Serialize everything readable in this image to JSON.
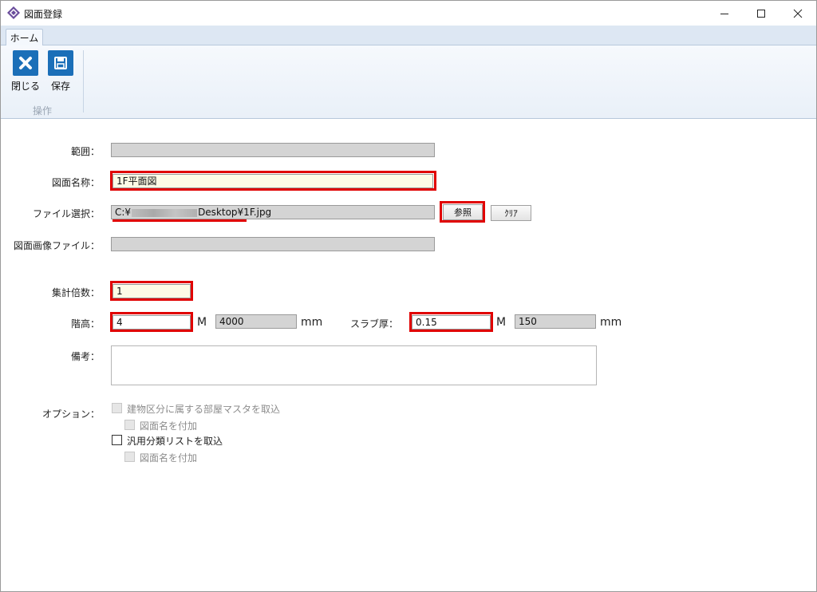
{
  "window": {
    "title": "図面登録"
  },
  "ribbon": {
    "tab": "ホーム",
    "close_label": "閉じる",
    "save_label": "保存",
    "group_label": "操作"
  },
  "form": {
    "range_label": "範囲：",
    "range_value": "",
    "drawing_name_label": "図面名称：",
    "drawing_name_value": "1F平面図",
    "file_select_label": "ファイル選択：",
    "file_path_prefix": "C:¥",
    "file_path_suffix": "Desktop¥1F.jpg",
    "browse_label": "参照",
    "clear_label": "ｸﾘｱ",
    "image_file_label": "図面画像ファイル：",
    "image_file_value": "",
    "multiplier_label": "集計倍数：",
    "multiplier_value": "1",
    "floor_height_label": "階高：",
    "floor_height_value": "4",
    "floor_height_unit": "M",
    "floor_height_mm_value": "4000",
    "floor_height_mm_unit": "mm",
    "slab_label": "スラブ厚：",
    "slab_value": "0.15",
    "slab_unit": "M",
    "slab_mm_value": "150",
    "slab_mm_unit": "mm",
    "remarks_label": "備考：",
    "remarks_value": "",
    "options_label": "オプション：",
    "options": {
      "import_room_master": "建物区分に属する部屋マスタを取込",
      "add_drawing_name_1": "図面名を付加",
      "import_category_list": "汎用分類リストを取込",
      "add_drawing_name_2": "図面名を付加"
    }
  }
}
